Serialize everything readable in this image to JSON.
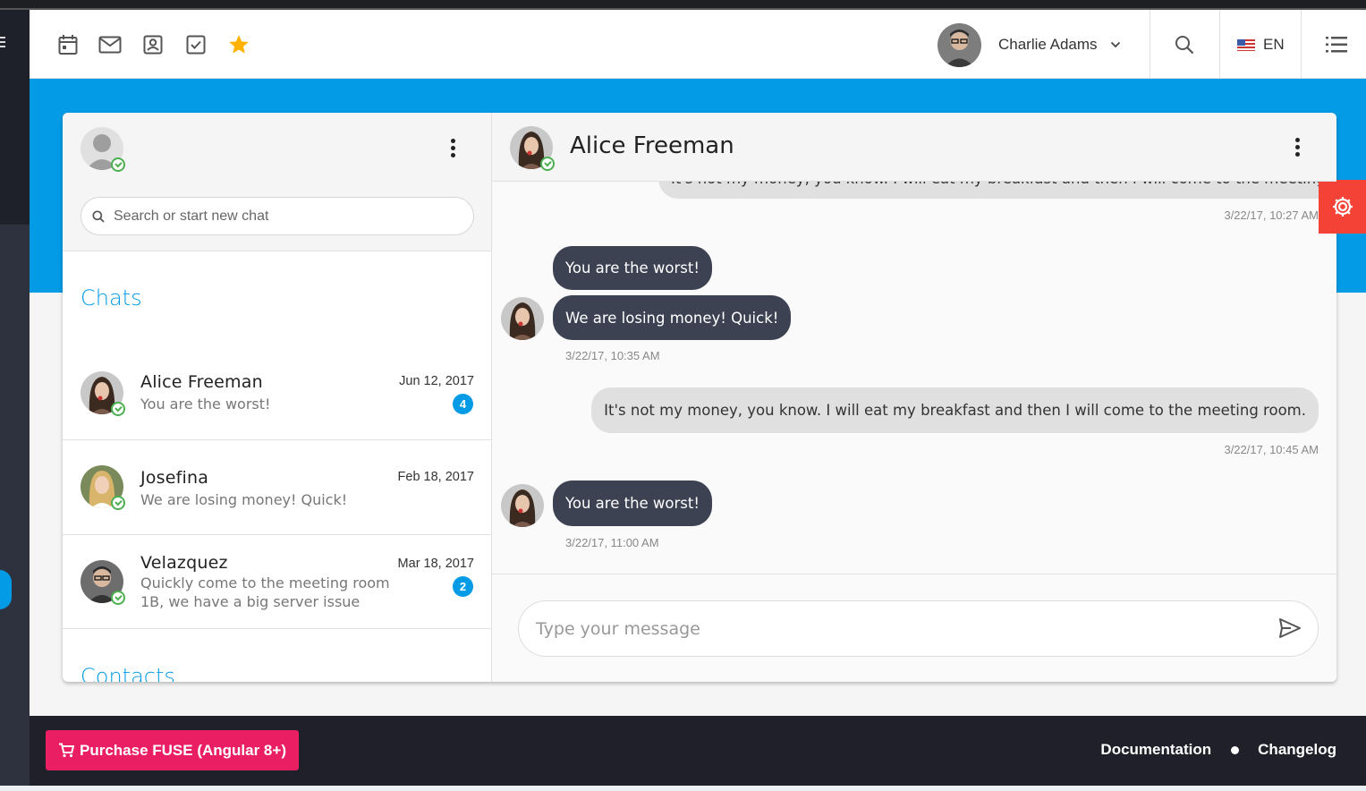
{
  "toolbar": {
    "shortcuts": [
      "calendar-icon",
      "mail-icon",
      "contacts-icon",
      "todo-icon",
      "star-icon"
    ],
    "user_name": "Charlie Adams",
    "language": "EN"
  },
  "sidebar": {
    "search_placeholder": "Search or start new chat",
    "chats_title": "Chats",
    "contacts_title": "Contacts",
    "chats": [
      {
        "name": "Alice Freeman",
        "last_message": "You are the worst!",
        "date": "Jun 12, 2017",
        "unread": "4"
      },
      {
        "name": "Josefina",
        "last_message": "We are losing money! Quick!",
        "date": "Feb 18, 2017",
        "unread": ""
      },
      {
        "name": "Velazquez",
        "last_message": "Quickly come to the meeting room 1B, we have a big server issue",
        "date": "Mar 18, 2017",
        "unread": "2"
      }
    ]
  },
  "conversation": {
    "contact_name": "Alice Freeman",
    "messages": [
      {
        "direction": "out",
        "text": "It's not my money, you know. I will eat my breakfast and then I will come to the meeting room.",
        "time": "3/22/17, 10:27 AM"
      },
      {
        "direction": "in",
        "text": "You are the worst!",
        "time": ""
      },
      {
        "direction": "in",
        "text": "We are losing money! Quick!",
        "time": "3/22/17, 10:35 AM"
      },
      {
        "direction": "out",
        "text": "It's not my money, you know. I will eat my breakfast and then I will come to the meeting room.",
        "time": "3/22/17, 10:45 AM"
      },
      {
        "direction": "in",
        "text": "You are the worst!",
        "time": "3/22/17, 11:00 AM"
      }
    ],
    "input_placeholder": "Type your message"
  },
  "footer": {
    "purchase_label": "Purchase FUSE (Angular 8+)",
    "documentation_label": "Documentation",
    "changelog_label": "Changelog"
  },
  "colors": {
    "accent": "#039be5",
    "dark_bubble": "#3c4252",
    "purchase": "#e91e63",
    "settings_tab": "#f44336",
    "online": "#4caf50"
  }
}
